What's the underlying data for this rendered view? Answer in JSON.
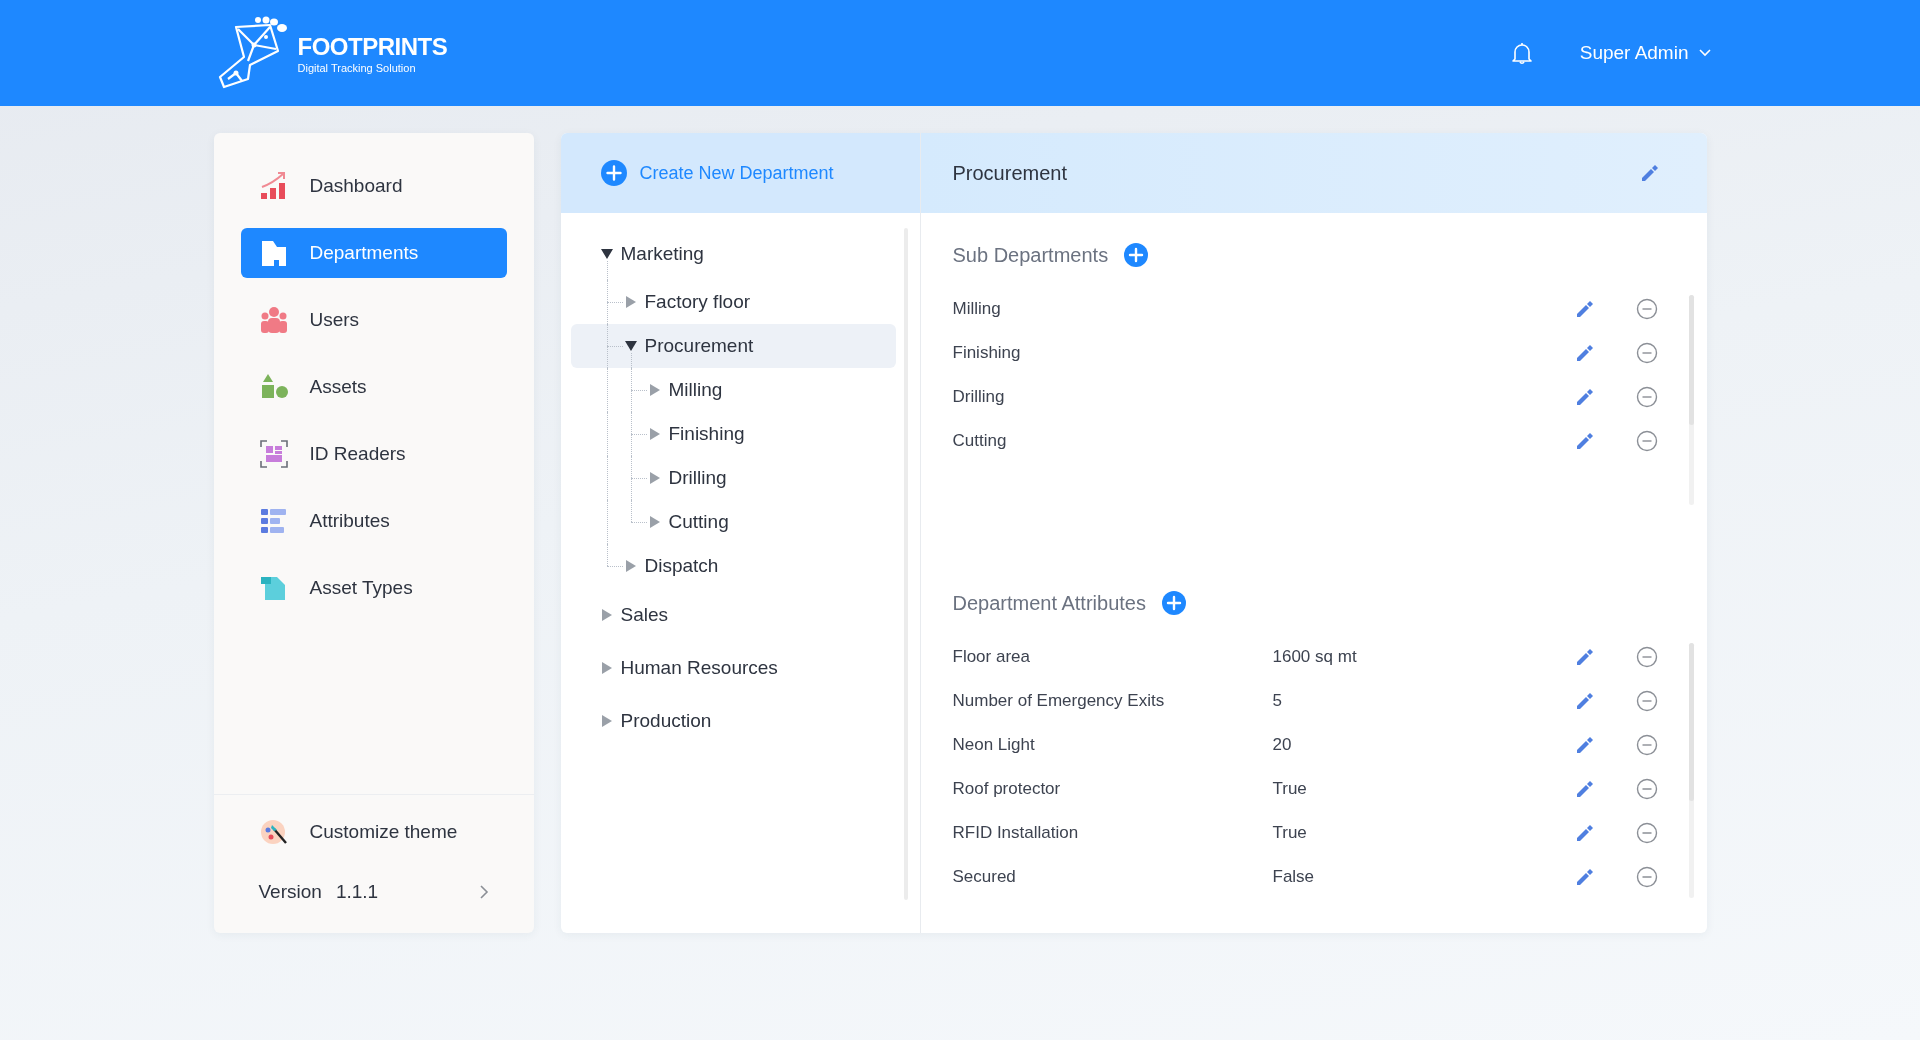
{
  "header": {
    "logo": {
      "title": "FOOTPRINTS",
      "subtitle": "Digital Tracking Solution"
    },
    "user_menu": "Super Admin"
  },
  "sidebar": {
    "items": [
      {
        "label": "Dashboard",
        "kind": "dashboard",
        "selected": false
      },
      {
        "label": "Departments",
        "kind": "departments",
        "selected": true
      },
      {
        "label": "Users",
        "kind": "users",
        "selected": false
      },
      {
        "label": "Assets",
        "kind": "assets",
        "selected": false
      },
      {
        "label": "ID Readers",
        "kind": "readers",
        "selected": false
      },
      {
        "label": "Attributes",
        "kind": "attributes",
        "selected": false
      },
      {
        "label": "Asset Types",
        "kind": "asset_types",
        "selected": false
      }
    ],
    "customize_theme": "Customize theme",
    "version": {
      "label": "Version",
      "value": "1.1.1"
    }
  },
  "tree": {
    "create_button": "Create New Department",
    "items": [
      {
        "label": "Marketing",
        "expanded": true,
        "selected": false,
        "children": [
          {
            "label": "Factory floor",
            "expanded": false,
            "selected": false
          },
          {
            "label": "Procurement",
            "expanded": true,
            "selected": true,
            "children": [
              {
                "label": "Milling",
                "expanded": false,
                "selected": false
              },
              {
                "label": "Finishing",
                "expanded": false,
                "selected": false
              },
              {
                "label": "Drilling",
                "expanded": false,
                "selected": false
              },
              {
                "label": "Cutting",
                "expanded": false,
                "selected": false
              }
            ]
          },
          {
            "label": "Dispatch",
            "expanded": false,
            "selected": false
          }
        ]
      },
      {
        "label": "Sales",
        "expanded": false,
        "selected": false
      },
      {
        "label": "Human Resources",
        "expanded": false,
        "selected": false
      },
      {
        "label": "Production",
        "expanded": false,
        "selected": false
      }
    ]
  },
  "detail": {
    "title": "Procurement",
    "sub_departments": {
      "heading": "Sub Departments",
      "items": [
        "Milling",
        "Finishing",
        "Drilling",
        "Cutting"
      ]
    },
    "attributes": {
      "heading": "Department Attributes",
      "rows": [
        {
          "name": "Floor area",
          "value": "1600 sq mt"
        },
        {
          "name": "Number of Emergency Exits",
          "value": "5"
        },
        {
          "name": "Neon Light",
          "value": "20"
        },
        {
          "name": "Roof protector",
          "value": "True"
        },
        {
          "name": "RFID Installation",
          "value": "True"
        },
        {
          "name": "Secured",
          "value": "False"
        }
      ]
    }
  }
}
